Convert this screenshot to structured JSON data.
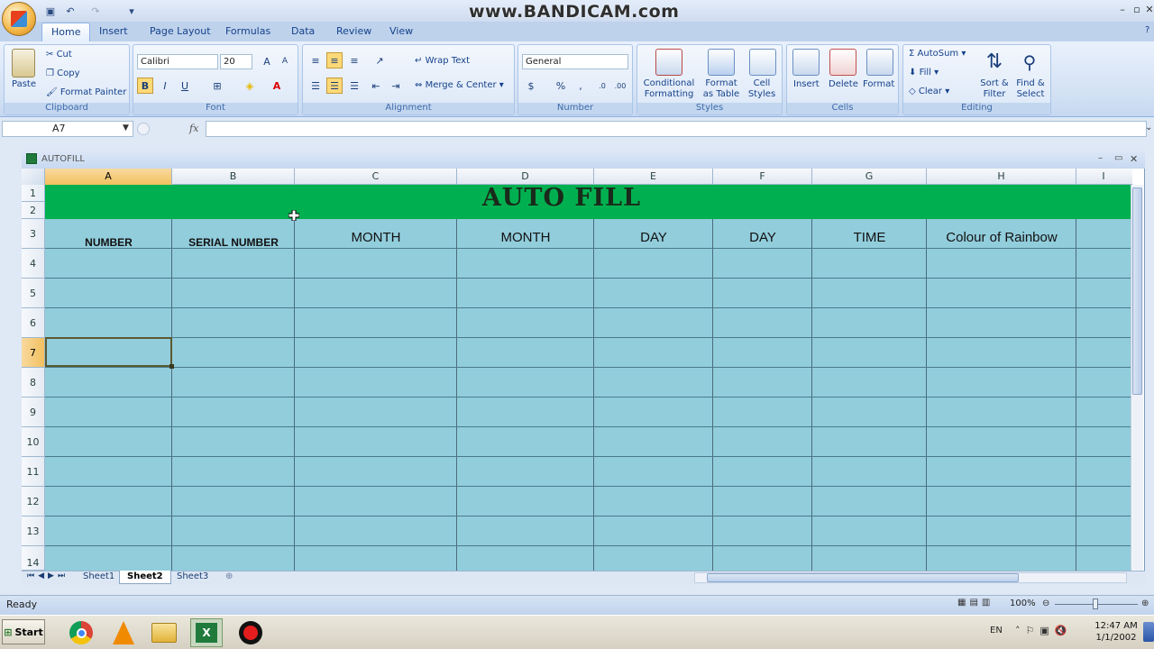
{
  "watermark": "www.BANDICAM.com",
  "tabs": [
    "Home",
    "Insert",
    "Page Layout",
    "Formulas",
    "Data",
    "Review",
    "View"
  ],
  "active_tab": "Home",
  "clipboard": {
    "paste": "Paste",
    "cut": "Cut",
    "copy": "Copy",
    "format_painter": "Format Painter",
    "label": "Clipboard"
  },
  "font": {
    "name": "Calibri",
    "size": "20",
    "label": "Font",
    "bold": "B",
    "italic": "I",
    "underline": "U"
  },
  "alignment": {
    "wrap": "Wrap Text",
    "merge": "Merge & Center",
    "label": "Alignment"
  },
  "number": {
    "format": "General",
    "label": "Number",
    "currency": "$",
    "percent": "%",
    "comma": ","
  },
  "styles": {
    "conditional": "Conditional",
    "conditional2": "Formatting",
    "format_table": "Format",
    "format_table2": "as Table",
    "cell_styles": "Cell",
    "cell_styles2": "Styles",
    "label": "Styles"
  },
  "cells": {
    "insert": "Insert",
    "delete": "Delete",
    "format": "Format",
    "label": "Cells"
  },
  "editing": {
    "autosum": "AutoSum",
    "fill": "Fill",
    "clear": "Clear",
    "sort": "Sort &",
    "sort2": "Filter",
    "find": "Find &",
    "find2": "Select",
    "label": "Editing"
  },
  "name_box": "A7",
  "fx": "fx",
  "workbook_title": "AUTOFILL",
  "columns": [
    "A",
    "B",
    "C",
    "D",
    "E",
    "F",
    "G",
    "H",
    "I"
  ],
  "rows": [
    "1",
    "2",
    "3",
    "4",
    "5",
    "6",
    "7",
    "8",
    "9",
    "10",
    "11",
    "12",
    "13",
    "14"
  ],
  "banner": "AUTO FILL",
  "headers": [
    "NUMBER",
    "SERIAL NUMBER",
    "MONTH",
    "MONTH",
    "DAY",
    "DAY",
    "TIME",
    "Colour of Rainbow"
  ],
  "sheets": [
    "Sheet1",
    "Sheet2",
    "Sheet3"
  ],
  "active_sheet": "Sheet2",
  "status": "Ready",
  "zoom": "100%",
  "taskbar": {
    "start": "Start",
    "lang": "EN",
    "time": "12:47 AM",
    "date": "1/1/2002"
  },
  "colors": {
    "banner_green": "#00b050",
    "grid_blue": "#92cddc",
    "selection_orange": "#f1c15f"
  }
}
